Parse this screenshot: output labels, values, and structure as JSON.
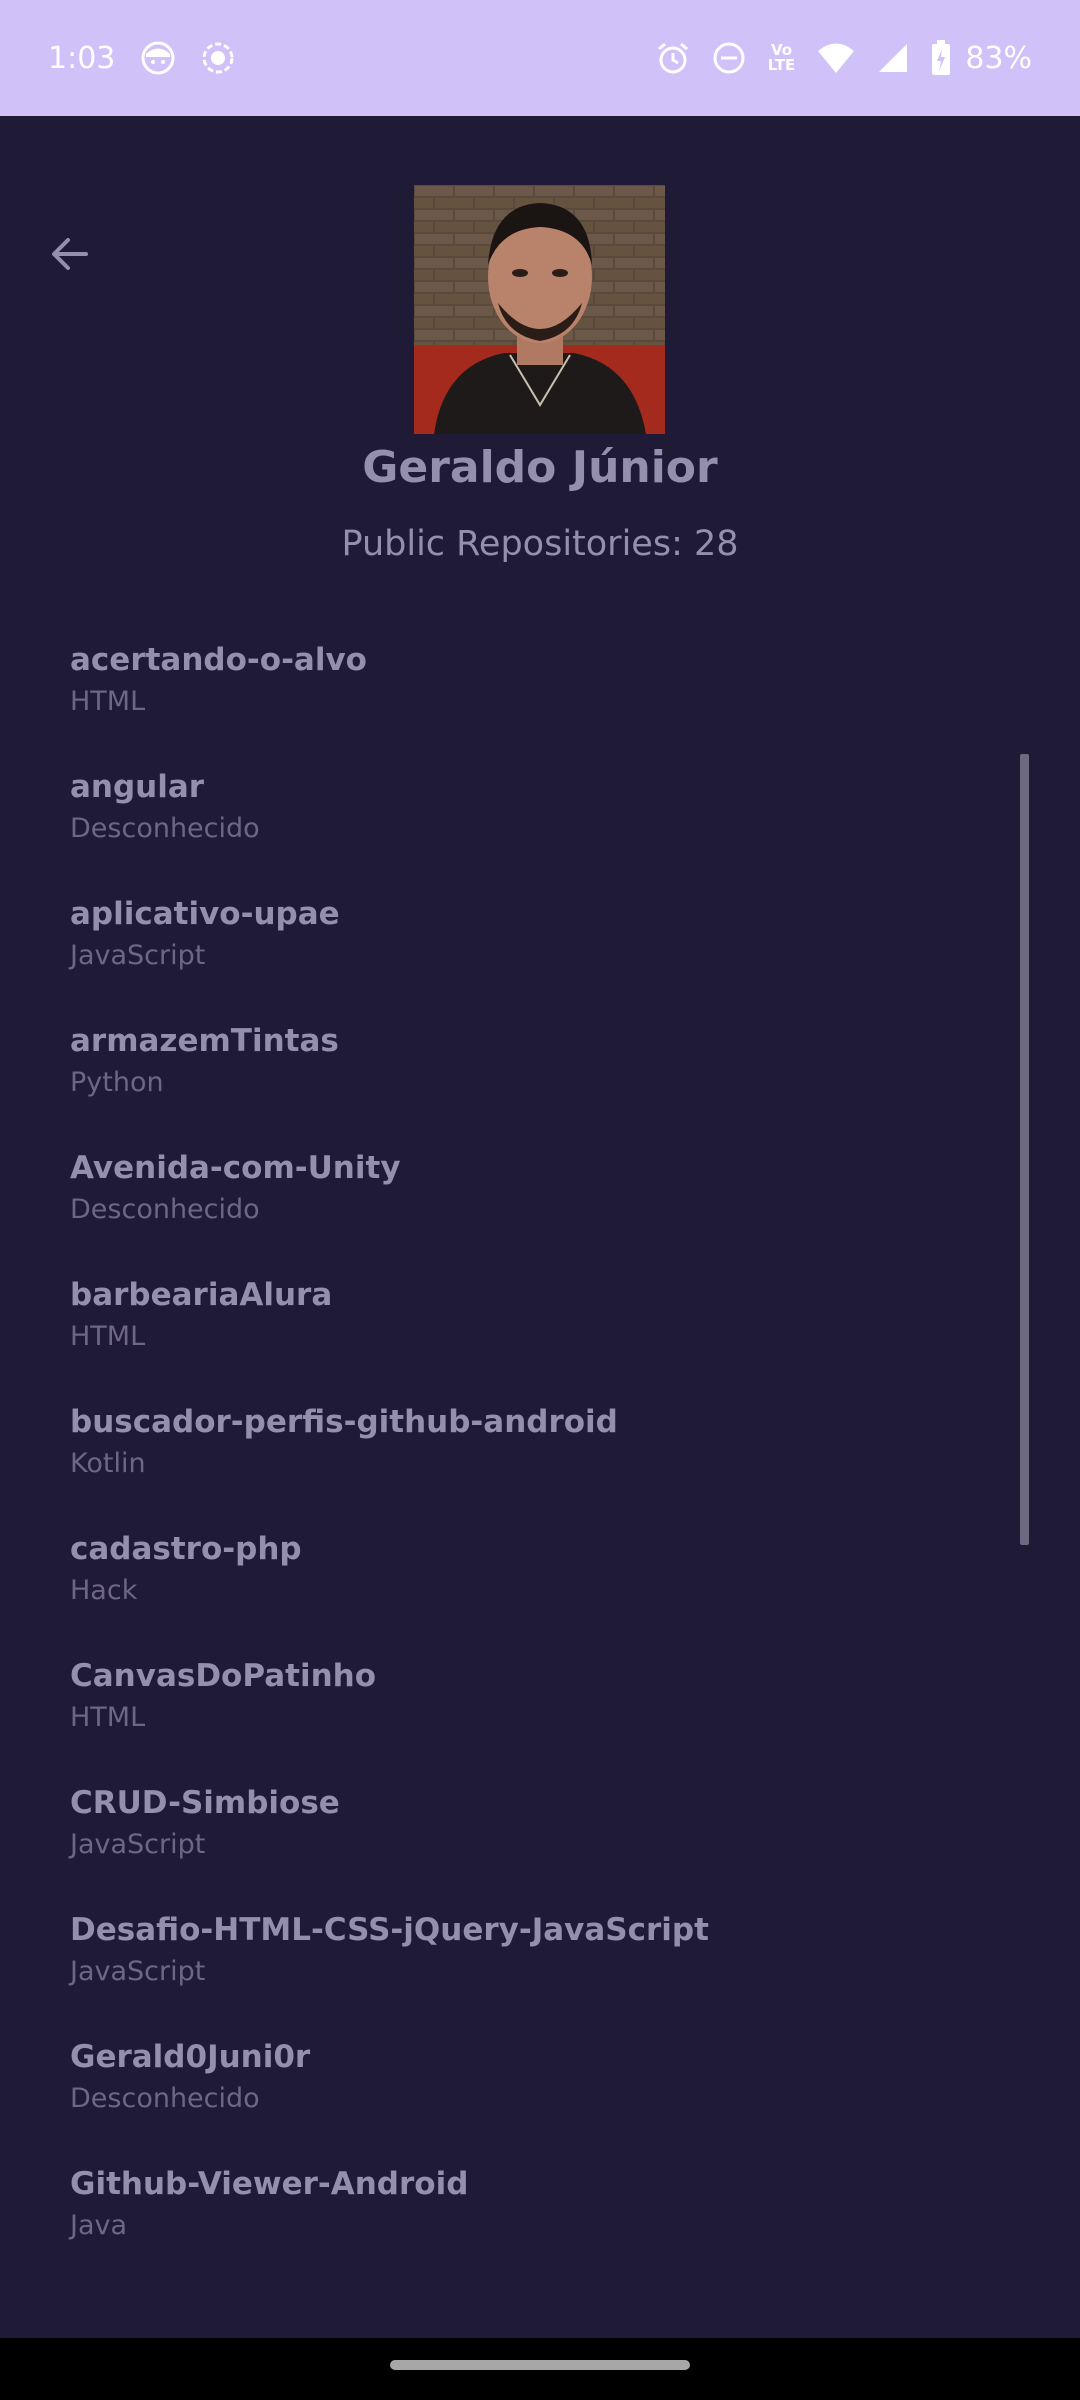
{
  "status_bar": {
    "time": "1:03",
    "battery": "83%",
    "lte_top": "Vo",
    "lte_bottom": "LTE",
    "icons": [
      "face-icon",
      "record-icon",
      "alarm-icon",
      "dnd-icon",
      "volte-icon",
      "wifi-icon",
      "signal-icon",
      "battery-icon"
    ]
  },
  "profile": {
    "name": "Geraldo Júnior",
    "public_repos": "Public Repositories: 28"
  },
  "repositories": [
    {
      "name": "acertando-o-alvo",
      "language": "HTML"
    },
    {
      "name": "angular",
      "language": "Desconhecido"
    },
    {
      "name": "aplicativo-upae",
      "language": "JavaScript"
    },
    {
      "name": "armazemTintas",
      "language": "Python"
    },
    {
      "name": "Avenida-com-Unity",
      "language": "Desconhecido"
    },
    {
      "name": "barbeariaAlura",
      "language": "HTML"
    },
    {
      "name": "buscador-perfis-github-android",
      "language": "Kotlin"
    },
    {
      "name": "cadastro-php",
      "language": "Hack"
    },
    {
      "name": "CanvasDoPatinho",
      "language": "HTML"
    },
    {
      "name": "CRUD-Simbiose",
      "language": "JavaScript"
    },
    {
      "name": "Desafio-HTML-CSS-jQuery-JavaScript",
      "language": "JavaScript"
    },
    {
      "name": "Gerald0Juni0r",
      "language": "Desconhecido"
    },
    {
      "name": "Github-Viewer-Android",
      "language": "Java"
    }
  ],
  "colors": {
    "status_bar": "#d1c1f9",
    "background": "#1f1a35",
    "text_primary": "#958fae",
    "text_secondary": "#6d6783"
  }
}
